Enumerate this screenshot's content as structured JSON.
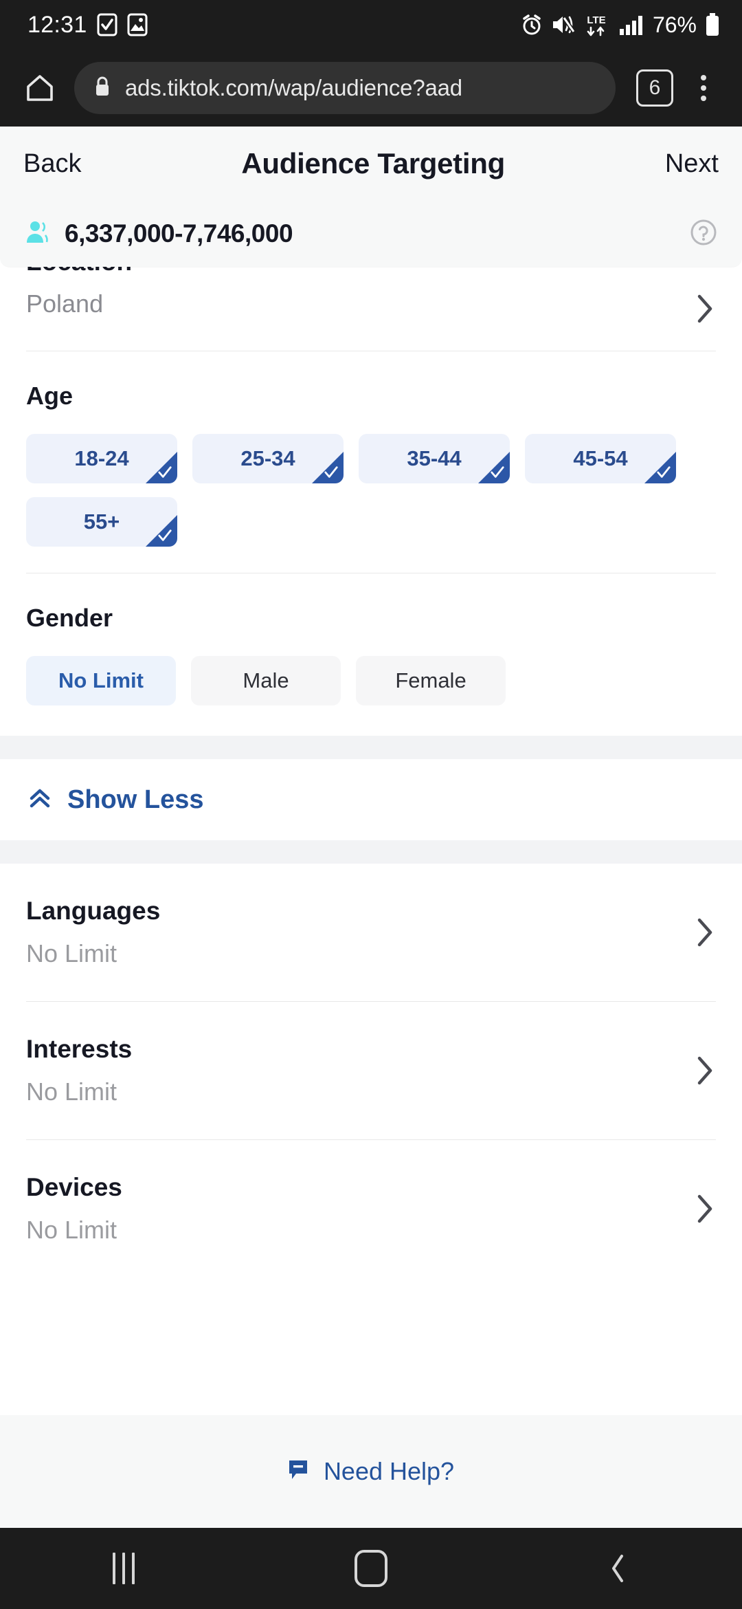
{
  "status_bar": {
    "time": "12:31",
    "battery_percent": "76%",
    "network": "LTE",
    "icons": [
      "checkbox-icon",
      "image-icon",
      "alarm-icon",
      "mute-icon",
      "lte-data-icon",
      "signal-bars-icon",
      "battery-icon"
    ]
  },
  "browser": {
    "url": "ads.tiktok.com/wap/audience?aad",
    "tab_count": "6",
    "icons": [
      "home-icon",
      "lock-icon",
      "tab-switcher-icon",
      "more-menu-icon"
    ]
  },
  "topbar": {
    "back_label": "Back",
    "title": "Audience Targeting",
    "next_label": "Next"
  },
  "audience_bar": {
    "count": "6,337,000-7,746,000",
    "people_icon": "people-icon",
    "help_icon": "help-circle-icon",
    "icon_color": "#5ce1e6"
  },
  "sections": {
    "location": {
      "title": "Location",
      "value": "Poland"
    },
    "age": {
      "title": "Age",
      "options": [
        {
          "label": "18-24",
          "selected": true
        },
        {
          "label": "25-34",
          "selected": true
        },
        {
          "label": "35-44",
          "selected": true
        },
        {
          "label": "45-54",
          "selected": true
        },
        {
          "label": "55+",
          "selected": true
        }
      ]
    },
    "gender": {
      "title": "Gender",
      "options": [
        {
          "label": "No Limit",
          "selected": true
        },
        {
          "label": "Male",
          "selected": false
        },
        {
          "label": "Female",
          "selected": false
        }
      ]
    },
    "show_less": {
      "label": "Show Less",
      "icon": "chevron-double-up-icon"
    },
    "list_rows": [
      {
        "title": "Languages",
        "value": "No Limit"
      },
      {
        "title": "Interests",
        "value": "No Limit"
      },
      {
        "title": "Devices",
        "value": "No Limit"
      }
    ]
  },
  "footer": {
    "help_label": "Need Help?",
    "icon": "chat-bubble-icon"
  },
  "nav_bar": {
    "recents": "recents-icon",
    "home": "home-button-icon",
    "back": "back-button-icon"
  },
  "colors": {
    "accent_blue": "#24539c",
    "chip_selected_bg": "#eef2fb",
    "chip_corner": "#2c57a7",
    "page_bg": "#ffffff",
    "bar_bg": "#f7f8f8"
  }
}
